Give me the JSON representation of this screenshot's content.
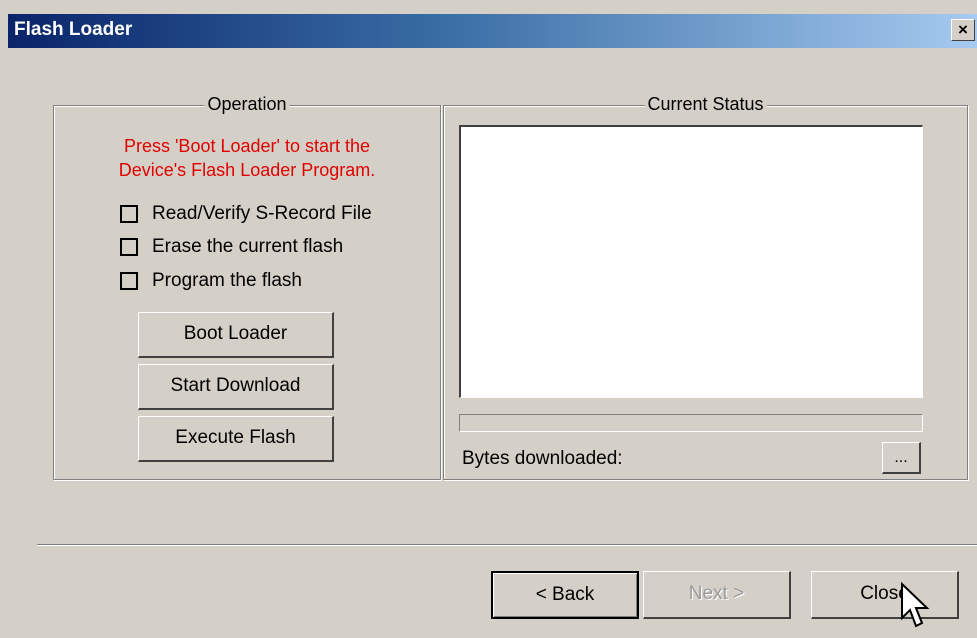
{
  "window": {
    "title": "Flash Loader",
    "close_glyph": "×"
  },
  "operation": {
    "legend": "Operation",
    "instruction_line1": "Press 'Boot Loader' to start the",
    "instruction_line2": "Device's Flash Loader Program.",
    "checkboxes": [
      {
        "label": "Read/Verify S-Record File",
        "checked": false
      },
      {
        "label": "Erase the current flash",
        "checked": false
      },
      {
        "label": "Program the flash",
        "checked": false
      }
    ],
    "buttons": {
      "boot_loader": "Boot Loader",
      "start_download": "Start Download",
      "execute_flash": "Execute Flash"
    }
  },
  "status": {
    "legend": "Current Status",
    "log_text": "",
    "progress_fraction": 0,
    "bytes_label": "Bytes downloaded:",
    "browse_label": "..."
  },
  "footer": {
    "back_label": "< Back",
    "next_label": "Next >",
    "close_label": "Close"
  },
  "colors": {
    "instruction_text": "#e00000",
    "face": "#d4d0c8",
    "title_start": "#0a246a",
    "title_end": "#a6caf0"
  },
  "icons": {
    "title_close": "close-icon",
    "pointer": "mouse-pointer-icon"
  }
}
